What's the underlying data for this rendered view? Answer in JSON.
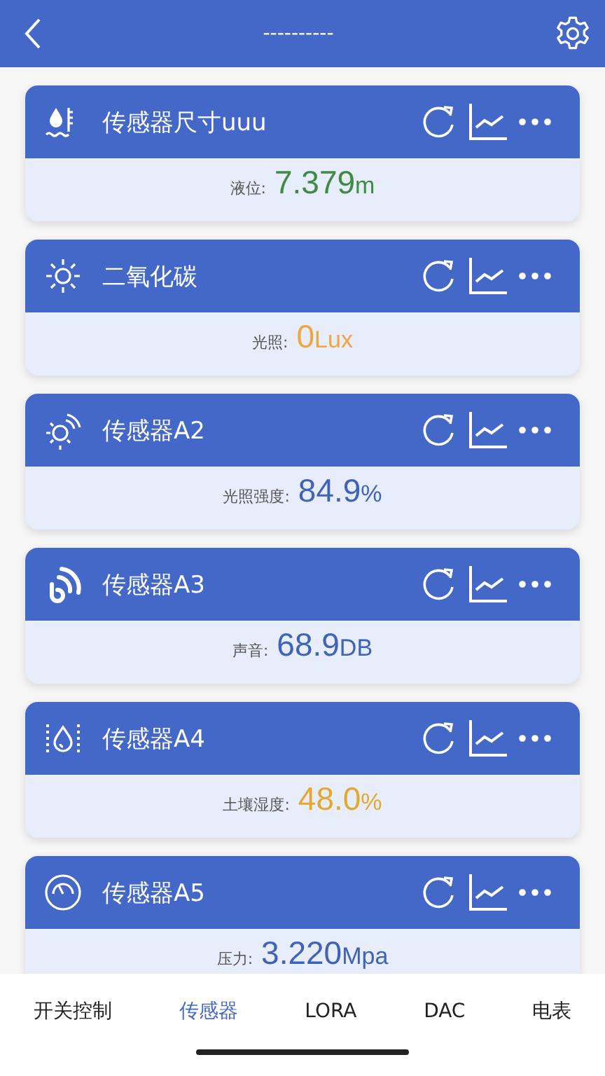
{
  "header": {
    "title": "----------"
  },
  "sensors": [
    {
      "name": "传感器尺寸uuu",
      "kind": "water-level",
      "label": "液位:",
      "value": "7.379",
      "unit": "m",
      "color": "#3f8a45"
    },
    {
      "name": "二氧化碳",
      "kind": "sun",
      "label": "光照:",
      "value": "0",
      "unit": "Lux",
      "color": "#eea640"
    },
    {
      "name": "传感器A2",
      "kind": "light-signal",
      "label": "光照强度:",
      "value": "84.9",
      "unit": "%",
      "color": "#3f63b8"
    },
    {
      "name": "传感器A3",
      "kind": "sound",
      "label": "声音:",
      "value": "68.9",
      "unit": "DB",
      "color": "#3f63b8"
    },
    {
      "name": "传感器A4",
      "kind": "humidity",
      "label": "土壤湿度:",
      "value": "48.0",
      "unit": "%",
      "color": "#e3a92e"
    },
    {
      "name": "传感器A5",
      "kind": "gauge",
      "label": "压力:",
      "value": "3.220",
      "unit": "Mpa",
      "color": "#3f63b8"
    }
  ],
  "tabs": [
    {
      "label": "开关控制",
      "selected": false
    },
    {
      "label": "传感器",
      "selected": true
    },
    {
      "label": "LORA",
      "selected": false
    },
    {
      "label": "DAC",
      "selected": false
    },
    {
      "label": "电表",
      "selected": false
    }
  ]
}
